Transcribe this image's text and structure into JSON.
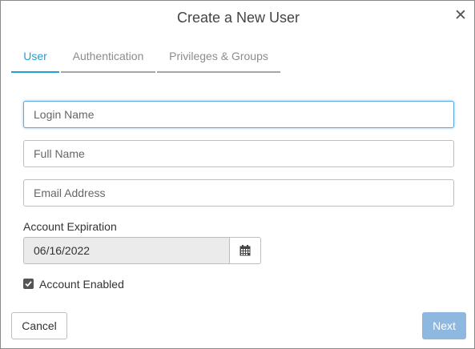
{
  "dialog": {
    "title": "Create a New User",
    "close_symbol": "✕"
  },
  "tabs": [
    {
      "label": "User",
      "active": true
    },
    {
      "label": "Authentication",
      "active": false
    },
    {
      "label": "Privileges & Groups",
      "active": false
    }
  ],
  "form": {
    "login_name": {
      "placeholder": "Login Name",
      "value": ""
    },
    "full_name": {
      "placeholder": "Full Name",
      "value": ""
    },
    "email_address": {
      "placeholder": "Email Address",
      "value": ""
    },
    "account_expiration": {
      "label": "Account Expiration",
      "value": "06/16/2022",
      "icon": "calendar-icon"
    },
    "account_enabled": {
      "label": "Account Enabled",
      "checked": true
    }
  },
  "buttons": {
    "cancel_label": "Cancel",
    "next_label": "Next"
  },
  "colors": {
    "accent": "#1f9fd4",
    "next_button": "#8fb8e0",
    "tab_inactive": "#8c8c8c"
  }
}
